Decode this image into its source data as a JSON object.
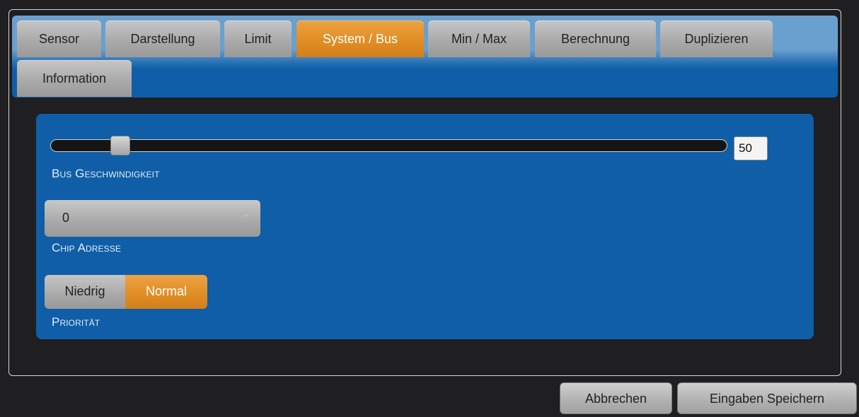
{
  "tabs": [
    {
      "label": "Sensor",
      "active": false
    },
    {
      "label": "Darstellung",
      "active": false
    },
    {
      "label": "Limit",
      "active": false
    },
    {
      "label": "System / Bus",
      "active": true
    },
    {
      "label": "Min / Max",
      "active": false
    },
    {
      "label": "Berechnung",
      "active": false
    },
    {
      "label": "Duplizieren",
      "active": false
    },
    {
      "label": "Information",
      "active": false
    }
  ],
  "bus_speed": {
    "label": "Bus Geschwindigkeit",
    "value": "50"
  },
  "chip_address": {
    "label": "Chip Adresse",
    "selected": "0"
  },
  "priority": {
    "label": "Priorität",
    "options": [
      "Niedrig",
      "Normal"
    ],
    "selected": "Normal"
  },
  "actions": {
    "cancel_label": "Abbrechen",
    "save_label": "Eingaben Speichern"
  },
  "colors": {
    "accent": "#e08e25",
    "panel": "#0f5ea7",
    "background": "#1f1e20"
  }
}
